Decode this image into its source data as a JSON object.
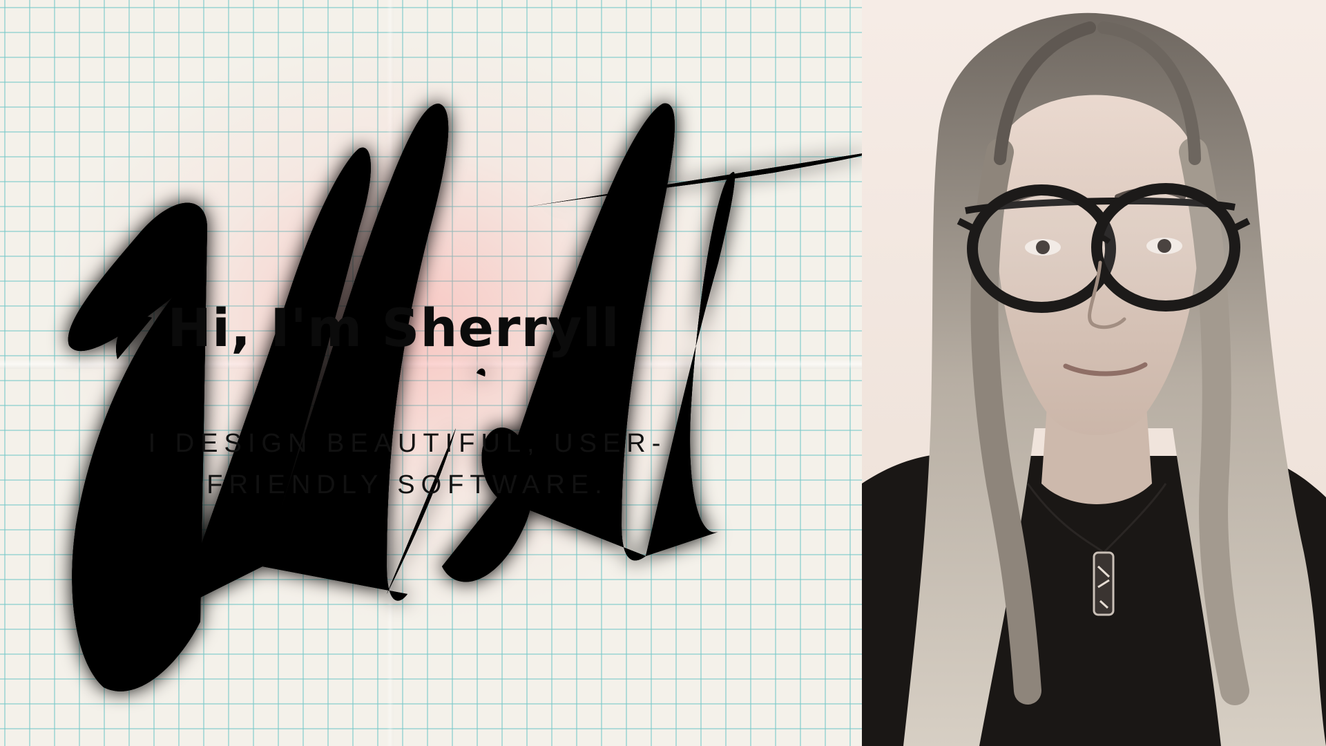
{
  "hero": {
    "greeting": "Hi, I'm Sherryll",
    "tagline_line1": "I DESIGN BEAUTIFUL, USER-",
    "tagline_line2": "FRIENDLY SOFTWARE.",
    "signature_text": "Elliott"
  },
  "colors": {
    "neon": "#ff4b57",
    "grid": "#78c8c8",
    "text": "#0b0b0b"
  },
  "icons": {
    "signature": "handwritten-signature-neon",
    "portrait": "person-photo-glasses"
  }
}
